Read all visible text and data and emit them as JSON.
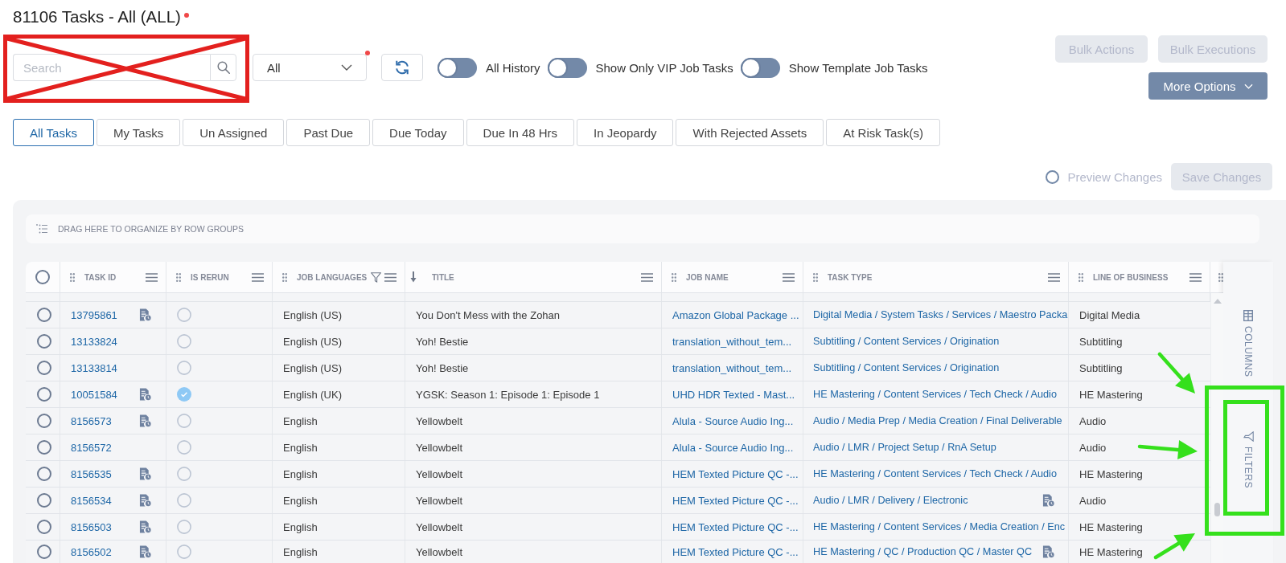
{
  "page_title": {
    "text": "81106 Tasks - All (ALL)",
    "badge_dot": true
  },
  "toolbar": {
    "search": {
      "placeholder": "Search"
    },
    "scope_select": {
      "value": "All",
      "badge_dot": true
    },
    "toggles": [
      {
        "label": "All History",
        "on": false
      },
      {
        "label": "Show Only VIP Job Tasks",
        "on": false
      },
      {
        "label": "Show Template Job Tasks",
        "on": false
      }
    ],
    "actions": [
      {
        "label": "Bulk Actions",
        "disabled": true
      },
      {
        "label": "Bulk Executions",
        "disabled": true
      }
    ],
    "more_options": {
      "label": "More Options"
    }
  },
  "tabs": [
    {
      "label": "All Tasks",
      "selected": true
    },
    {
      "label": "My Tasks",
      "selected": false
    },
    {
      "label": "Un Assigned",
      "selected": false
    },
    {
      "label": "Past Due",
      "selected": false
    },
    {
      "label": "Due Today",
      "selected": false
    },
    {
      "label": "Due In 48 Hrs",
      "selected": false
    },
    {
      "label": "In Jeopardy",
      "selected": false
    },
    {
      "label": "With Rejected Assets",
      "selected": false
    },
    {
      "label": "At Risk Task(s)",
      "selected": false
    }
  ],
  "changes_bar": {
    "preview": {
      "label": "Preview Changes",
      "checked": false,
      "disabled": true
    },
    "save": {
      "label": "Save Changes",
      "disabled": true
    }
  },
  "grid": {
    "row_group_hint": "DRAG HERE TO ORGANIZE BY ROW GROUPS",
    "select_all": false,
    "columns": [
      {
        "label": "TASK ID",
        "filtered": false,
        "sorted": false
      },
      {
        "label": "IS RERUN",
        "filtered": false,
        "sorted": false
      },
      {
        "label": "JOB LANGUAGES",
        "filtered": true,
        "sorted": false
      },
      {
        "label": "TITLE",
        "filtered": false,
        "sorted": true
      },
      {
        "label": "JOB NAME",
        "filtered": false,
        "sorted": false
      },
      {
        "label": "TASK TYPE",
        "filtered": false,
        "sorted": false
      },
      {
        "label": "LINE OF BUSINESS",
        "filtered": false,
        "sorted": false
      }
    ],
    "rows": [
      {
        "selected": false,
        "task_id": "13795861",
        "task_doc_icon": true,
        "is_rerun": false,
        "job_languages": "English (US)",
        "title": "You Don't Mess with the Zohan",
        "job_name": "Amazon Global Package ...",
        "task_type": "Digital Media / System Tasks / Services / Maestro Packa",
        "type_doc_icon": false,
        "line_of_business": "Digital Media"
      },
      {
        "selected": false,
        "task_id": "13133824",
        "task_doc_icon": false,
        "is_rerun": false,
        "job_languages": "English (US)",
        "title": "Yoh! Bestie",
        "job_name": "translation_without_tem...",
        "task_type": "Subtitling / Content Services / Origination",
        "type_doc_icon": false,
        "line_of_business": "Subtitling"
      },
      {
        "selected": false,
        "task_id": "13133814",
        "task_doc_icon": false,
        "is_rerun": false,
        "job_languages": "English (US)",
        "title": "Yoh! Bestie",
        "job_name": "translation_without_tem...",
        "task_type": "Subtitling / Content Services / Origination",
        "type_doc_icon": false,
        "line_of_business": "Subtitling"
      },
      {
        "selected": false,
        "task_id": "10051584",
        "task_doc_icon": true,
        "is_rerun": true,
        "job_languages": "English (UK)",
        "title": "YGSK: Season 1: Episode 1: Episode 1",
        "job_name": "UHD HDR Texted - Mast...",
        "task_type": "HE Mastering / Content Services / Tech Check / Audio",
        "type_doc_icon": false,
        "line_of_business": "HE Mastering"
      },
      {
        "selected": false,
        "task_id": "8156573",
        "task_doc_icon": true,
        "is_rerun": false,
        "job_languages": "English",
        "title": "Yellowbelt",
        "job_name": "Alula - Source Audio Ing...",
        "task_type": "Audio / Media Prep / Media Creation / Final Deliverable",
        "type_doc_icon": false,
        "line_of_business": "Audio"
      },
      {
        "selected": false,
        "task_id": "8156572",
        "task_doc_icon": false,
        "is_rerun": false,
        "job_languages": "English",
        "title": "Yellowbelt",
        "job_name": "Alula - Source Audio Ing...",
        "task_type": "Audio / LMR / Project Setup / RnA Setup",
        "type_doc_icon": false,
        "line_of_business": "Audio"
      },
      {
        "selected": false,
        "task_id": "8156535",
        "task_doc_icon": true,
        "is_rerun": false,
        "job_languages": "English",
        "title": "Yellowbelt",
        "job_name": "HEM Texted Picture QC -...",
        "task_type": "HE Mastering / Content Services / Tech Check / Audio",
        "type_doc_icon": false,
        "line_of_business": "HE Mastering"
      },
      {
        "selected": false,
        "task_id": "8156534",
        "task_doc_icon": true,
        "is_rerun": false,
        "job_languages": "English",
        "title": "Yellowbelt",
        "job_name": "HEM Texted Picture QC -...",
        "task_type": "Audio / LMR / Delivery / Electronic",
        "type_doc_icon": true,
        "line_of_business": "Audio"
      },
      {
        "selected": false,
        "task_id": "8156503",
        "task_doc_icon": true,
        "is_rerun": false,
        "job_languages": "English",
        "title": "Yellowbelt",
        "job_name": "HEM Texted Picture QC -...",
        "task_type": "HE Mastering / Content Services / Media Creation / Enc",
        "type_doc_icon": false,
        "line_of_business": "HE Mastering"
      },
      {
        "selected": false,
        "task_id": "8156502",
        "task_doc_icon": true,
        "is_rerun": false,
        "job_languages": "English",
        "title": "Yellowbelt",
        "job_name": "HEM Texted Picture QC -...",
        "task_type": "HE Mastering / QC / Production QC / Master QC",
        "type_doc_icon": true,
        "line_of_business": "HE Mastering"
      }
    ]
  },
  "side_panel": {
    "tabs": [
      {
        "kind": "columns",
        "label": "COLUMNS",
        "selected": false
      },
      {
        "kind": "filters",
        "label": "FILTERS",
        "selected": false
      }
    ]
  },
  "annotations": [
    {
      "kind": "cross-out"
    },
    {
      "kind": "frame"
    },
    {
      "kind": "frame"
    },
    {
      "kind": "arrow"
    },
    {
      "kind": "arrow"
    },
    {
      "kind": "arrow"
    }
  ]
}
